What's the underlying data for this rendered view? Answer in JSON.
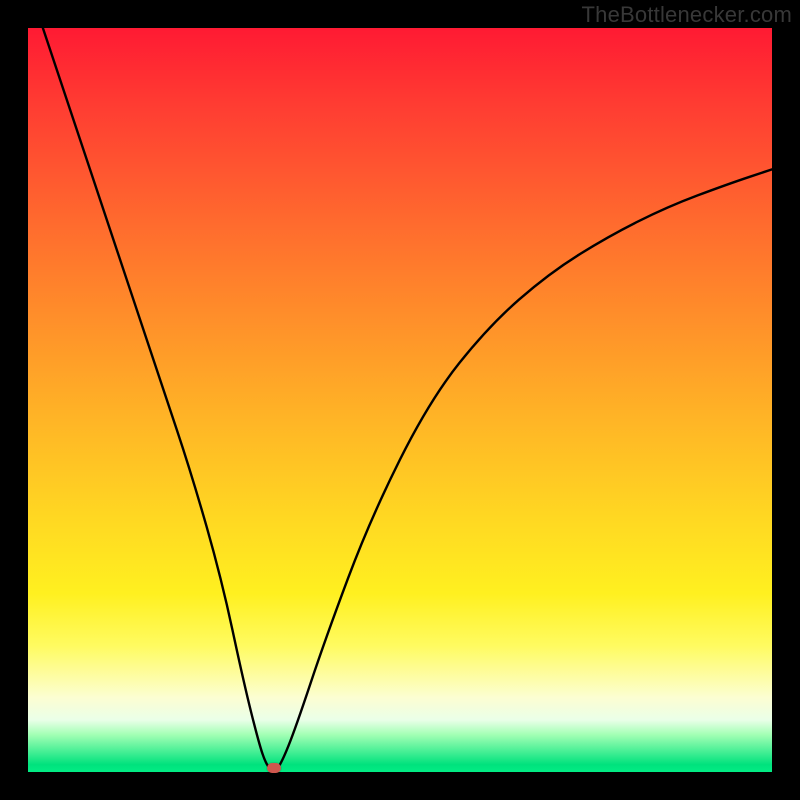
{
  "watermark": "TheBottlenecker.com",
  "chart_data": {
    "type": "line",
    "title": "",
    "xlabel": "",
    "ylabel": "",
    "xlim": [
      0,
      100
    ],
    "ylim": [
      0,
      100
    ],
    "series": [
      {
        "name": "bottleneck-curve",
        "x": [
          2,
          6,
          10,
          14,
          18,
          22,
          26,
          29,
          31,
          32,
          33,
          34,
          36,
          40,
          46,
          54,
          62,
          70,
          78,
          86,
          94,
          100
        ],
        "y": [
          100,
          88,
          76,
          64,
          52,
          40,
          26,
          12,
          4,
          1,
          0,
          1,
          6,
          18,
          34,
          50,
          60,
          67,
          72,
          76,
          79,
          81
        ]
      }
    ],
    "annotations": [
      {
        "name": "dip-marker",
        "x": 33,
        "y": 0.6,
        "color": "#cf574e"
      }
    ],
    "background_gradient": {
      "stops": [
        {
          "pos": 0,
          "color": "#ff1a33"
        },
        {
          "pos": 10,
          "color": "#ff3b32"
        },
        {
          "pos": 26,
          "color": "#ff6a2e"
        },
        {
          "pos": 38,
          "color": "#ff8c2a"
        },
        {
          "pos": 52,
          "color": "#ffb326"
        },
        {
          "pos": 66,
          "color": "#ffd822"
        },
        {
          "pos": 76,
          "color": "#fff020"
        },
        {
          "pos": 83,
          "color": "#fffb60"
        },
        {
          "pos": 90,
          "color": "#fcfed2"
        },
        {
          "pos": 93,
          "color": "#eaffe8"
        },
        {
          "pos": 95,
          "color": "#a2ffb4"
        },
        {
          "pos": 99,
          "color": "#00e27d"
        },
        {
          "pos": 100,
          "color": "#02ec84"
        }
      ]
    }
  }
}
